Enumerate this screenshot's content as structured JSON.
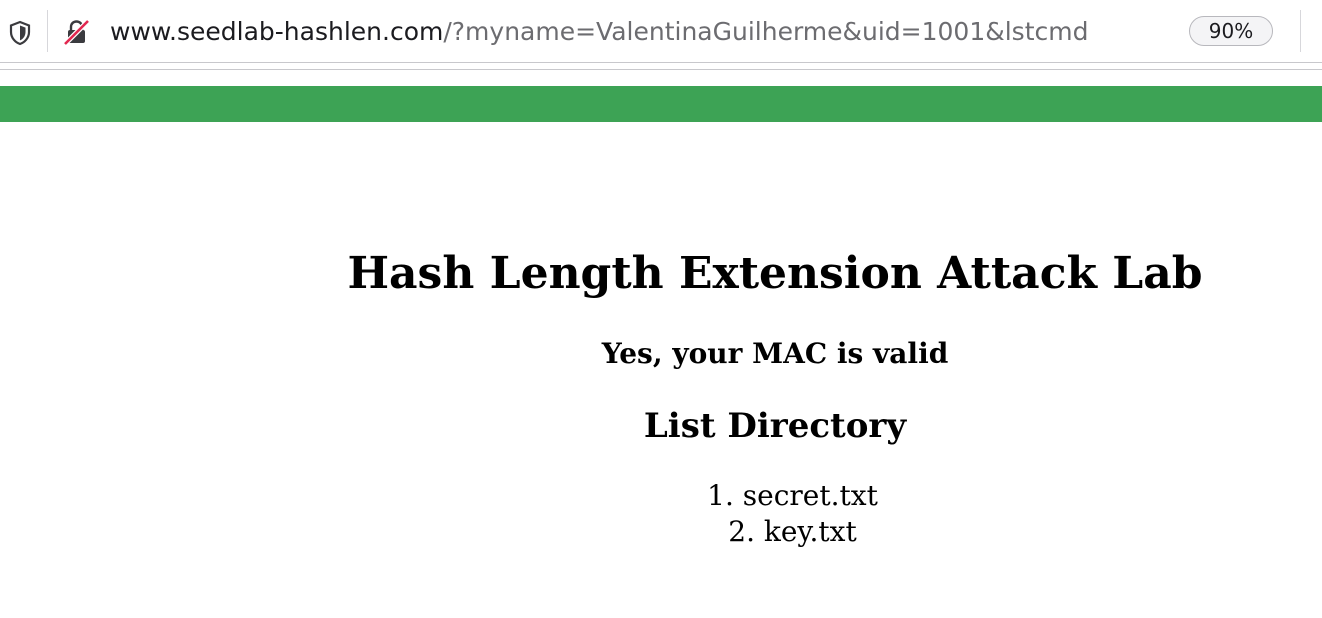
{
  "browser": {
    "url_host": "www.seedlab-hashlen.com",
    "url_rest": "/?myname=ValentinaGuilherme&uid=1001&lstcmd",
    "zoom": "90%",
    "icons": {
      "tracking": "shield-icon",
      "connection": "insecure-lock-icon"
    }
  },
  "page": {
    "banner_color": "#3da355",
    "title": "Hash Length Extension Attack Lab",
    "status": "Yes, your MAC is valid",
    "list_heading": "List Directory",
    "files": [
      {
        "number": "1.",
        "name": "secret.txt"
      },
      {
        "number": "2.",
        "name": "key.txt"
      }
    ]
  }
}
